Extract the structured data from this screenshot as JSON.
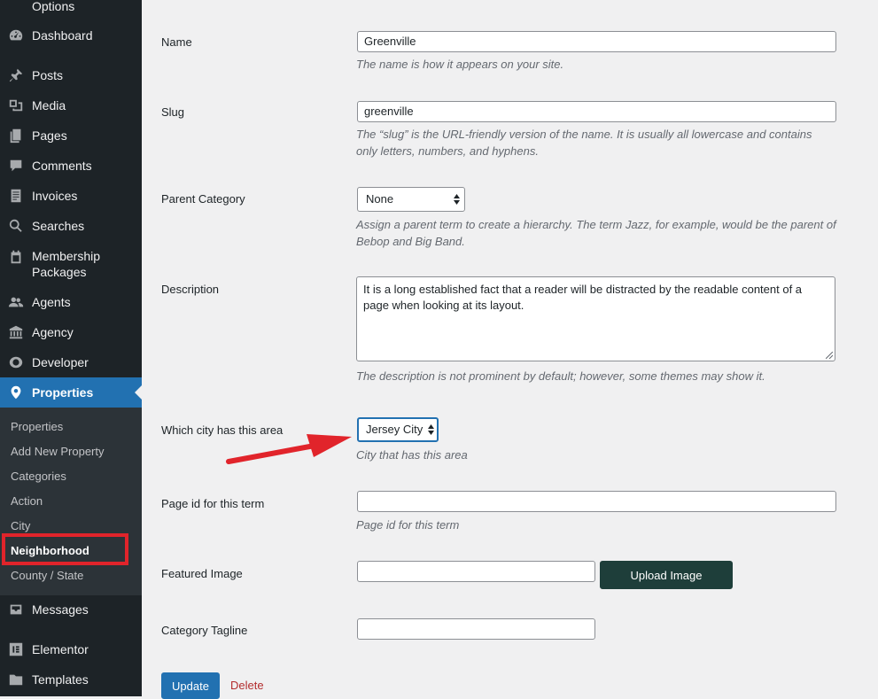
{
  "sidebar": {
    "items": [
      {
        "label": "Options",
        "icon": "options-icon"
      },
      {
        "label": "Dashboard",
        "icon": "dashboard-icon"
      },
      {
        "label": "Posts",
        "icon": "pin-icon"
      },
      {
        "label": "Media",
        "icon": "media-icon"
      },
      {
        "label": "Pages",
        "icon": "pages-icon"
      },
      {
        "label": "Comments",
        "icon": "comment-icon"
      },
      {
        "label": "Invoices",
        "icon": "invoice-icon"
      },
      {
        "label": "Searches",
        "icon": "search-icon"
      },
      {
        "label": "Membership Packages",
        "label_line1": "Membership",
        "label_line2": "Packages",
        "icon": "calendar-icon"
      },
      {
        "label": "Agents",
        "icon": "agents-icon"
      },
      {
        "label": "Agency",
        "icon": "bank-icon"
      },
      {
        "label": "Developer",
        "icon": "developer-icon"
      },
      {
        "label": "Properties",
        "icon": "location-pin-icon"
      },
      {
        "label": "Messages",
        "icon": "inbox-icon"
      },
      {
        "label": "Elementor",
        "icon": "elementor-icon"
      },
      {
        "label": "Templates",
        "icon": "folder-icon"
      }
    ],
    "submenu": [
      {
        "label": "Properties"
      },
      {
        "label": "Add New Property"
      },
      {
        "label": "Categories"
      },
      {
        "label": "Action"
      },
      {
        "label": "City"
      },
      {
        "label": "Neighborhood"
      },
      {
        "label": "County / State"
      }
    ]
  },
  "form": {
    "name": {
      "label": "Name",
      "value": "Greenville",
      "hint": "The name is how it appears on your site."
    },
    "slug": {
      "label": "Slug",
      "value": "greenville",
      "hint_line1": "The “slug” is the URL-friendly version of the name. It is usually all lowercase and contains",
      "hint_line2": "only letters, numbers, and hyphens."
    },
    "parent": {
      "label": "Parent Category",
      "selected": "None",
      "hint_line1": "Assign a parent term to create a hierarchy. The term Jazz, for example, would be the parent of",
      "hint_line2": "Bebop and Big Band."
    },
    "description": {
      "label": "Description",
      "value_line1": "It is a long established fact that a reader will be distracted by the readable content of a",
      "value_line2": "page when looking at its layout.",
      "hint": "The description is not prominent by default; however, some themes may show it."
    },
    "city": {
      "label": "Which city has this area",
      "selected": "Jersey City",
      "hint": "City that has this area"
    },
    "page_id": {
      "label": "Page id for this term",
      "value": "",
      "hint": "Page id for this term"
    },
    "featured_image": {
      "label": "Featured Image",
      "value": "",
      "button": "Upload Image"
    },
    "tagline": {
      "label": "Category Tagline",
      "value": ""
    },
    "update_button": "Update",
    "delete_link": "Delete"
  },
  "colors": {
    "sidebar_bg": "#1d2327",
    "submenu_bg": "#2c3338",
    "accent": "#2271b1",
    "upload_button": "#1e3e3a",
    "annotation_red": "#e1242b",
    "delete_red": "#b32d2e"
  }
}
